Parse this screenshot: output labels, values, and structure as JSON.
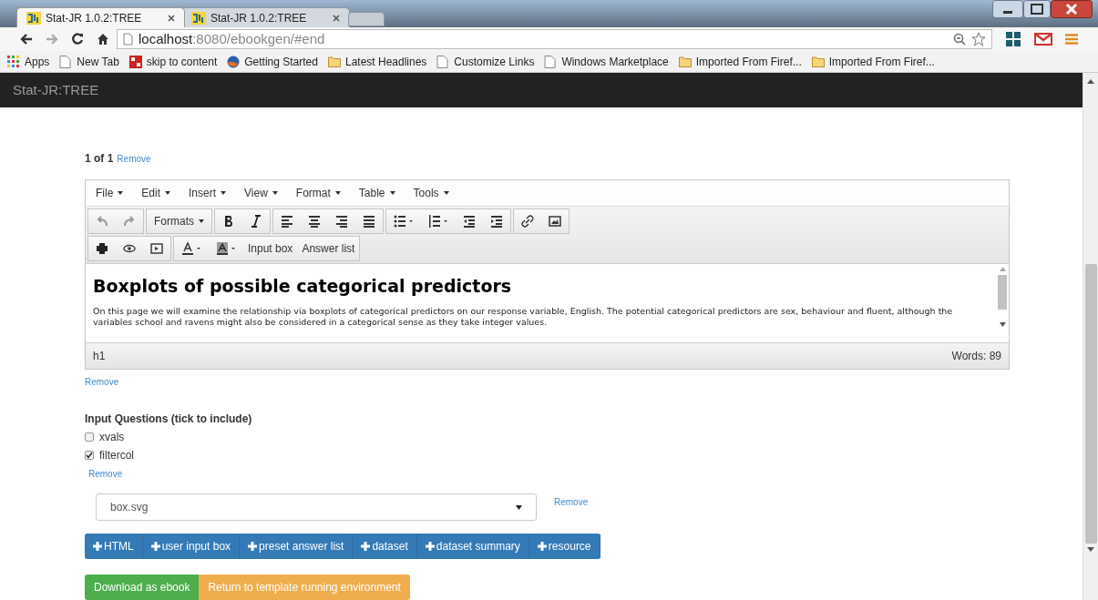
{
  "browser_tabs": [
    {
      "title": "Stat-JR 1.0.2:TREE",
      "selected": true
    },
    {
      "title": "Stat-JR 1.0.2:TREE",
      "selected": false
    }
  ],
  "address": {
    "host": "localhost",
    "path": ":8080/ebookgen/#end"
  },
  "bookmarks": [
    {
      "label": "Apps",
      "kind": "apps"
    },
    {
      "label": "New Tab",
      "kind": "page"
    },
    {
      "label": "skip to content",
      "kind": "tiles"
    },
    {
      "label": "Getting Started",
      "kind": "globe"
    },
    {
      "label": "Latest Headlines",
      "kind": "folder"
    },
    {
      "label": "Customize Links",
      "kind": "page"
    },
    {
      "label": "Windows Marketplace",
      "kind": "page"
    },
    {
      "label": "Imported From Firef...",
      "kind": "folder"
    },
    {
      "label": "Imported From Firef...",
      "kind": "folder"
    }
  ],
  "app_title": "Stat-JR:TREE",
  "counter": "1 of 1",
  "remove_links": [
    "Remove",
    "Remove",
    "Remove",
    "Remove"
  ],
  "editor": {
    "menus": [
      "File",
      "Edit",
      "Insert",
      "View",
      "Format",
      "Table",
      "Tools"
    ],
    "formats_label": "Formats",
    "text_buttons": [
      "Input box",
      "Answer list"
    ],
    "heading": "Boxplots of possible categorical predictors",
    "paragraph": "On this page we will examine the relationship via boxplots of categorical predictors on our response variable, English. The potential categorical predictors are sex, behaviour and fluent, although the variables school and ravens might also be considered in a categorical sense as they take integer values.",
    "path": "h1",
    "word_count": "Words: 89"
  },
  "questions": {
    "title": "Input Questions (tick to include)",
    "items": [
      {
        "label": "xvals",
        "checked": false
      },
      {
        "label": "filtercol",
        "checked": true
      }
    ]
  },
  "select_value": "box.svg",
  "add_buttons": [
    "HTML",
    "user input box",
    "preset answer list",
    "dataset",
    "dataset summary",
    "resource"
  ],
  "actions": [
    {
      "label": "Download as ebook",
      "color": "#4cae4c"
    },
    {
      "label": "Return to template running environment",
      "color": "#f0ad4e"
    }
  ]
}
